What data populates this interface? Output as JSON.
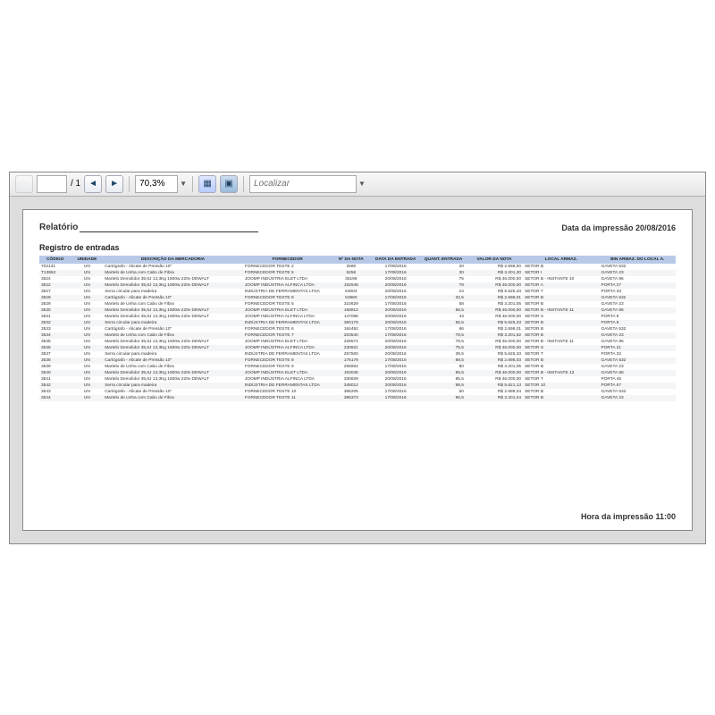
{
  "toolbar": {
    "page_total": "/ 1",
    "zoom": "70,3%",
    "search_placeholder": "Localizar"
  },
  "report": {
    "title": "Relatório",
    "print_date_label": "Data da impressão 20/08/2016",
    "section": "Registro de entradas",
    "print_time_label": "Hora da impressão 11:00"
  },
  "columns": [
    "CÓDIGO",
    "UNIDADE",
    "DESCRIÇÃO DA MERCADORIA",
    "FORNECEDOR",
    "Nº DA NOTA",
    "DATA DA ENTRADA",
    "QUANT. ENTRADA",
    "VALOR DA NOTA",
    "LOCAL ARMAZ.",
    "BIN ARMAZ. DO LOCAL A."
  ],
  "rows": [
    {
      "code": "702131",
      "un": "UN",
      "desc": "Cartógrafo - Alicate de Pressão 10\"",
      "forn": "FORNECEDOR TESTE 2",
      "nota": "2580",
      "data": "17/08/2016",
      "qty": "20",
      "val": "R$ 2.698,00",
      "loc": "SETOR B",
      "bin": "GAVETA 532"
    },
    {
      "code": "T13852",
      "un": "UN",
      "desc": "Martelo de Unha com Cabo de Fibra",
      "forn": "FORNECEDOR TESTE 5",
      "nota": "5256",
      "data": "17/08/2016",
      "qty": "30",
      "val": "R$ 3.201,30",
      "loc": "SETOR I",
      "bin": "GAVETA 23"
    },
    {
      "code": "3524",
      "un": "UN",
      "desc": "Martelo Demolidor 35,6J 13,3Kg 1600w 220v DEWALT",
      "forn": "JOOMP INDÚSTRIA ELET LTDA",
      "nota": "35198",
      "data": "20/08/2016",
      "qty": "75",
      "val": "R$ 46.000,00",
      "loc": "SETOR B - INSTANTE 10",
      "bin": "GAVETA 86"
    },
    {
      "code": "3522",
      "un": "UN",
      "desc": "Martelo Demolidor 35,6J 13,3Kg 1600w 220v DEWALT",
      "forn": "JOOMP INDÚSTRIA ALFINCA LTDA",
      "nota": "162545",
      "data": "20/08/2016",
      "qty": "78",
      "val": "R$ 46.000,00",
      "loc": "SETOR A",
      "bin": "PORTA 27"
    },
    {
      "code": "3527",
      "un": "UN",
      "desc": "Serra circular para madeira",
      "forn": "INDÚSTRIA DE FERRAMENTAS LTDA",
      "nota": "63004",
      "data": "20/08/2016",
      "qty": "24",
      "val": "R$ 5.625,33",
      "loc": "SETOR T",
      "bin": "PORTA 33"
    },
    {
      "code": "3528",
      "un": "UN",
      "desc": "Cartógrafo - Alicate de Pressão 10\"",
      "forn": "FORNECEDOR TESTE 8",
      "nota": "53980",
      "data": "17/08/2016",
      "qty": "32,5",
      "val": "R$ 2.698,01",
      "loc": "SETOR B",
      "bin": "GAVETA 532"
    },
    {
      "code": "3529",
      "un": "UN",
      "desc": "Martelo de Unha com Cabo de Fibra",
      "forn": "FORNECEDOR TESTE 5",
      "nota": "310629",
      "data": "17/08/2016",
      "qty": "58",
      "val": "R$ 3.201,05",
      "loc": "SETOR B",
      "bin": "GAVETA 23"
    },
    {
      "code": "3530",
      "un": "UN",
      "desc": "Martelo Demolidor 35,6J 13,3Kg 1600w 220v DEWALT",
      "forn": "JOOMP INDÚSTRIA ELET LTDA",
      "nota": "158812",
      "data": "20/08/2016",
      "qty": "56,5",
      "val": "R$ 46.000,00",
      "loc": "SETOR B - INSTANTE 11",
      "bin": "GAVETA 86"
    },
    {
      "code": "3531",
      "un": "UN",
      "desc": "Martelo Demolidor 35,6J 13,3Kg 1600w 220v DEWALT",
      "forn": "JOOMP INDÚSTRIA ALFINCA LTDA",
      "nota": "147086",
      "data": "20/08/2016",
      "qty": "43",
      "val": "R$ 46.000,00",
      "loc": "SETOR S",
      "bin": "PORTA 9"
    },
    {
      "code": "3532",
      "un": "UN",
      "desc": "Serra circular para madeira",
      "forn": "INDÚSTRIA DE FERRAMENTAS LTDA",
      "nota": "360179",
      "data": "20/08/2016",
      "qty": "55,5",
      "val": "R$ 5.625,33",
      "loc": "SETOR B",
      "bin": "PORTA 9"
    },
    {
      "code": "3533",
      "un": "UN",
      "desc": "Cartógrafo - Alicate de Pressão 10\"",
      "forn": "FORNECEDOR TESTE 6",
      "nota": "184492",
      "data": "17/08/2016",
      "qty": "66",
      "val": "R$ 2.698,01",
      "loc": "SETOR B",
      "bin": "GAVETA 532"
    },
    {
      "code": "3534",
      "un": "UN",
      "desc": "Martelo de Unha com Cabo de Fibra",
      "forn": "FORNECEDOR TESTE 7",
      "nota": "203540",
      "data": "17/08/2016",
      "qty": "78,5",
      "val": "R$ 3.201,52",
      "loc": "SETOR B",
      "bin": "GAVETA 23"
    },
    {
      "code": "3535",
      "un": "UN",
      "desc": "Martelo Demolidor 35,6J 13,3Kg 1600w 220v DEWALT",
      "forn": "JOOMP INDÚSTRIA ELET LTDA",
      "nota": "226574",
      "data": "20/08/2016",
      "qty": "76,5",
      "val": "R$ 46.000,00",
      "loc": "SETOR B - INSTANTE 11",
      "bin": "GAVETA 86"
    },
    {
      "code": "3536",
      "un": "UN",
      "desc": "Martelo Demolidor 35,6J 13,3Kg 1600w 220v DEWALT",
      "forn": "JOOMP INDÚSTRIA ALFINCA LTDA",
      "nota": "230831",
      "data": "20/08/2016",
      "qty": "75,5",
      "val": "R$ 46.000,00",
      "loc": "SETOR S",
      "bin": "PORTA 21"
    },
    {
      "code": "3537",
      "un": "UN",
      "desc": "Serra circular para madeira",
      "forn": "INDÚSTRIA DE FERRAMENTAS LTDA",
      "nota": "257500",
      "data": "20/08/2016",
      "qty": "39,5",
      "val": "R$ 5.625,33",
      "loc": "SETOR T",
      "bin": "PORTA 32"
    },
    {
      "code": "3538",
      "un": "UN",
      "desc": "Cartógrafo - Alicate de Pressão 10\"",
      "forn": "FORNECEDOR TESTE 8",
      "nota": "175179",
      "data": "17/08/2016",
      "qty": "88,5",
      "val": "R$ 2.698,03",
      "loc": "SETOR B",
      "bin": "GAVETA 532"
    },
    {
      "code": "3539",
      "un": "UN",
      "desc": "Martelo de Unha com Cabo de Fibra",
      "forn": "FORNECEDOR TESTE 9",
      "nota": "255862",
      "data": "17/08/2016",
      "qty": "80",
      "val": "R$ 3.201,05",
      "loc": "SETOR B",
      "bin": "GAVETA 23"
    },
    {
      "code": "3540",
      "un": "UN",
      "desc": "Martelo Demolidor 35,6J 13,3Kg 1600w 220v DEWALT",
      "forn": "JOOMP INDÚSTRIA ELET LTDA",
      "nota": "163045",
      "data": "20/08/2016",
      "qty": "85,5",
      "val": "R$ 46.000,00",
      "loc": "SETOR B - INSTANTE 13",
      "bin": "GAVETA 86"
    },
    {
      "code": "3541",
      "un": "UN",
      "desc": "Martelo Demolidor 35,6J 13,3Kg 1600w 220v DEWALT",
      "forn": "JOOMP INDÚSTRIA ALFINCA LTDA",
      "nota": "330829",
      "data": "20/08/2016",
      "qty": "85,5",
      "val": "R$ 46.000,00",
      "loc": "SETOR T",
      "bin": "PORTA 45"
    },
    {
      "code": "3542",
      "un": "UN",
      "desc": "Serra circular para madeira",
      "forn": "INDÚSTRIA DE FERRAMENTAS LTDA",
      "nota": "348012",
      "data": "20/08/2016",
      "qty": "98,5",
      "val": "R$ 5.621,13",
      "loc": "SETOR 10",
      "bin": "PORTA 57"
    },
    {
      "code": "3543",
      "un": "UN",
      "desc": "Cartógrafo - Alicate de Pressão 10\"",
      "forn": "FORNECEDOR TESTE 10",
      "nota": "366205",
      "data": "17/08/2016",
      "qty": "50",
      "val": "R$ 2.698,04",
      "loc": "SETOR B",
      "bin": "GAVETA 532"
    },
    {
      "code": "3544",
      "un": "UN",
      "desc": "Martelo de Unha com Cabo de Fibra",
      "forn": "FORNECEDOR TESTE 11",
      "nota": "386373",
      "data": "17/08/2016",
      "qty": "95,5",
      "val": "R$ 3.201,04",
      "loc": "SETOR B",
      "bin": "GAVETA 23"
    }
  ]
}
